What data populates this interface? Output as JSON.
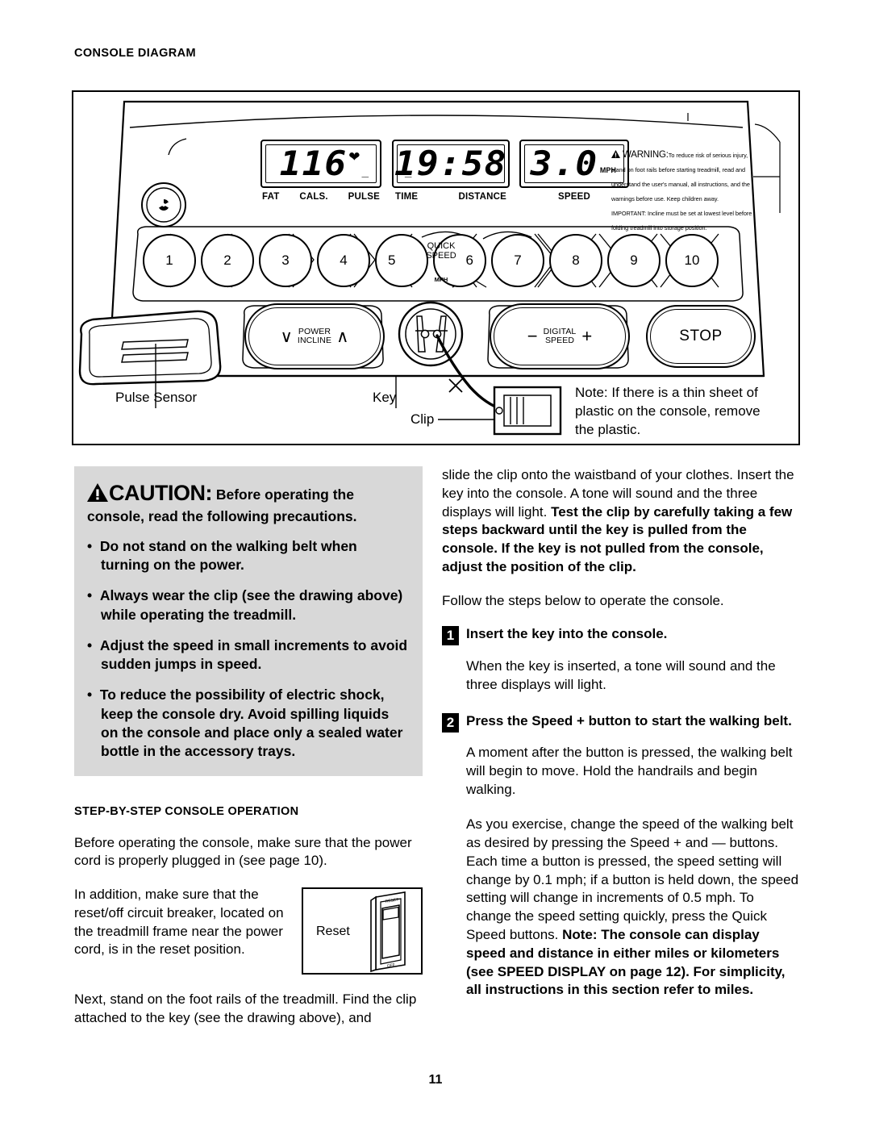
{
  "page": {
    "number": "11"
  },
  "console_diagram": {
    "heading": "CONSOLE DIAGRAM",
    "displays": [
      {
        "id": "pulse-display",
        "value": "116",
        "heart_icon": "heart-icon",
        "labels": [
          "FAT",
          "CALS.",
          "PULSE"
        ]
      },
      {
        "id": "time-distance-display",
        "value": "19:58",
        "labels": [
          "TIME",
          "DISTANCE"
        ]
      },
      {
        "id": "speed-display",
        "value": "3.0",
        "unit": "MPH",
        "labels": [
          "SPEED"
        ]
      }
    ],
    "quick_speed": {
      "title_line1": "QUICK",
      "title_line2": "SPEED",
      "unit": "MPH",
      "buttons": [
        "1",
        "2",
        "3",
        "4",
        "5",
        "6",
        "7",
        "8",
        "9",
        "10"
      ]
    },
    "power_incline": {
      "down": "∨",
      "line1": "POWER",
      "line2": "INCLINE",
      "up": "∧"
    },
    "digital_speed": {
      "minus": "−",
      "line1": "DIGITAL",
      "line2": "SPEED",
      "plus": "+"
    },
    "stop_button": "STOP",
    "warning_decal": {
      "title": "WARNING:",
      "body": "To reduce risk of serious injury, stand on foot rails before starting treadmill, read and understand the user's manual, all instructions, and the warnings before use. Keep children away.  IMPORTANT: Incline must be set at lowest level before folding treadmill into storage position."
    },
    "callouts": {
      "pulse_sensor": "Pulse Sensor",
      "key": "Key",
      "clip": "Clip"
    },
    "note": "Note: If there is a thin sheet of plastic on the console, remove the plastic."
  },
  "caution": {
    "word": "CAUTION:",
    "lead": " Before operating the console, read the following precautions.",
    "bullets": [
      "Do not stand on the walking belt when turning on the power.",
      "Always wear the clip (see the drawing above) while operating the treadmill.",
      "Adjust the speed in small increments to avoid sudden jumps in speed.",
      "To reduce the possibility of electric shock, keep the console dry. Avoid spilling liquids on the console and place only a sealed water bottle in the accessory trays."
    ]
  },
  "step_by_step": {
    "heading": "STEP-BY-STEP CONSOLE OPERATION",
    "intro": "Before operating the console, make sure that the power cord is properly plugged in (see page 10).",
    "reset_paragraph": "In addition, make sure that the reset/off circuit breaker, located on the treadmill frame near the power cord, is in the reset position.",
    "reset_figure": {
      "label": "Reset",
      "switch_top": "RESET",
      "switch_bottom": "OFF"
    },
    "next_paragraph": "Next, stand on the foot rails of the treadmill. Find the clip attached to the key (see the drawing above), and"
  },
  "right_column": {
    "continuation_plain": "slide the clip onto the waistband of your clothes. Insert the key into the console. A tone will sound and the three displays will light. ",
    "continuation_bold": "Test the clip by carefully taking a few steps backward until the key is pulled from the console. If the key is not pulled from the console, adjust the position of the clip.",
    "follow": "Follow the steps below to operate the console.",
    "steps": [
      {
        "number": "1",
        "title": "Insert the key into the console.",
        "body": "When the key is inserted, a tone will sound and the three displays will light."
      },
      {
        "number": "2",
        "title": "Press the Speed + button to start the walking belt.",
        "body": "A moment after the button is pressed, the walking belt will begin to move. Hold the handrails and begin walking."
      }
    ],
    "speed_paragraph_plain": "As you exercise, change the speed of the walking belt as desired by pressing the Speed + and — buttons. Each time a button is pressed, the speed setting will change by 0.1 mph; if a button is held down, the speed setting will change in increments of 0.5 mph. To change the speed setting quickly, press the Quick Speed buttons. ",
    "speed_paragraph_bold": "Note: The console can display speed and distance in either miles or kilometers (see SPEED DISPLAY on page 12). For simplicity, all instructions in this section refer to miles."
  }
}
